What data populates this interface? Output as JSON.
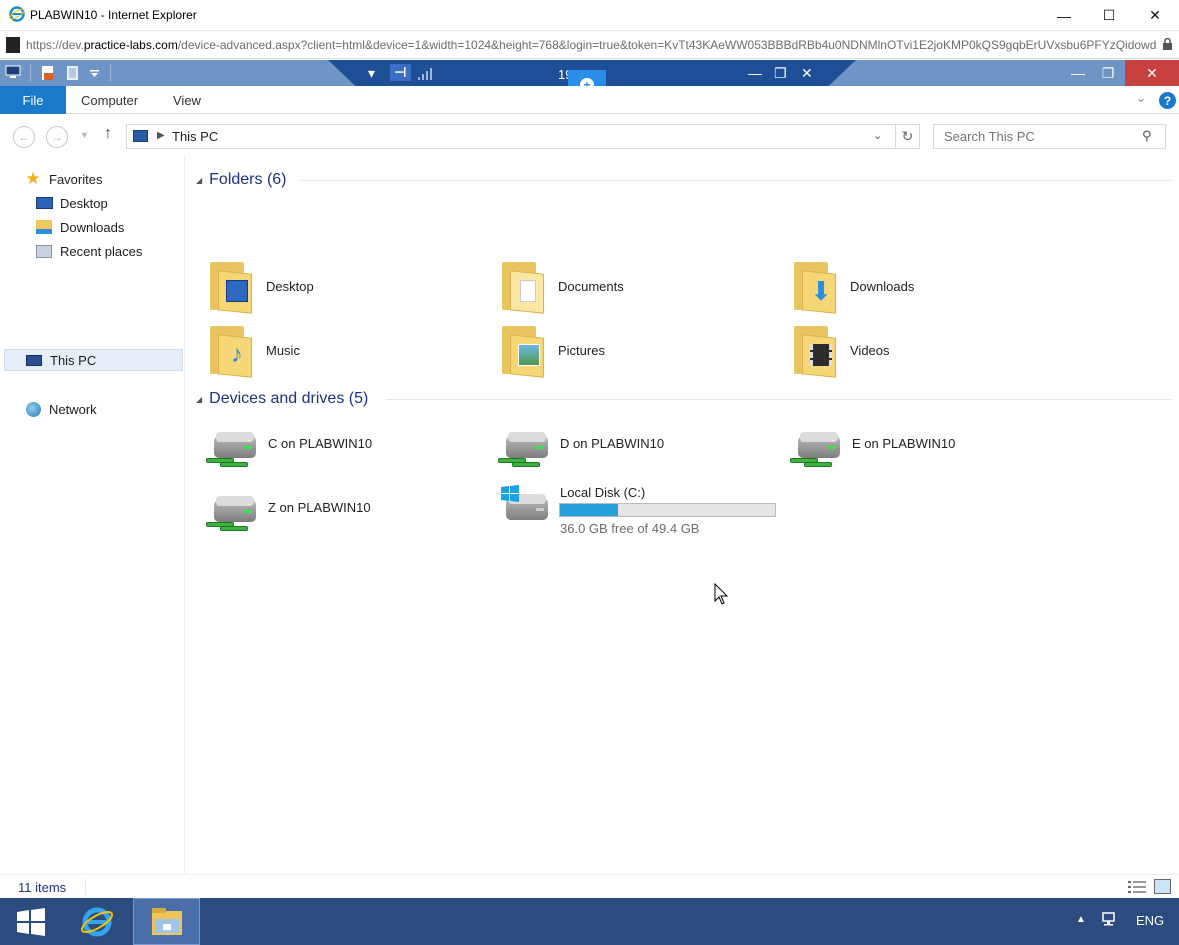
{
  "browser": {
    "title": "PLABWIN10 - Internet Explorer",
    "url_prefix": "https://dev.",
    "url_domain": "practice-labs.com",
    "url_rest": "/device-advanced.aspx?client=html&device=1&width=1024&height=768&login=true&token=KvTt43KAeWW053BBBdRBb4u0NDNMlnOTvi1E2joKMP0kQS9gqbErUVxsbu6PFYzQidowdX",
    "controls": {
      "minimize": "—",
      "maximize": "☐",
      "close": "✕"
    }
  },
  "rdp_toolbar": {
    "label": "19    0.3"
  },
  "ribbon": {
    "file_label": "File",
    "tabs": [
      "Computer",
      "View"
    ],
    "help": "?"
  },
  "navbar": {
    "location": "This PC",
    "search_placeholder": "Search This PC"
  },
  "navpane": {
    "favorites_label": "Favorites",
    "favorites": [
      "Desktop",
      "Downloads",
      "Recent places"
    ],
    "this_pc_label": "This PC",
    "network_label": "Network"
  },
  "folders_group": {
    "header": "Folders (6)",
    "items": [
      "Desktop",
      "Documents",
      "Downloads",
      "Music",
      "Pictures",
      "Videos"
    ]
  },
  "drives_group": {
    "header": "Devices and drives (5)",
    "network_drives": [
      "C on PLABWIN10",
      "D on PLABWIN10",
      "E on PLABWIN10",
      "Z on PLABWIN10"
    ],
    "local_disk": {
      "name": "Local Disk (C:)",
      "free_text": "36.0 GB free of 49.4 GB",
      "used_fraction": 0.271
    }
  },
  "statusbar": {
    "count": "11 items"
  },
  "taskbar": {
    "lang": "ENG"
  },
  "colors": {
    "accent": "#1979ca",
    "titlebar": "#6f95c7",
    "taskbar": "#2c4b7e",
    "close": "#c74141"
  }
}
